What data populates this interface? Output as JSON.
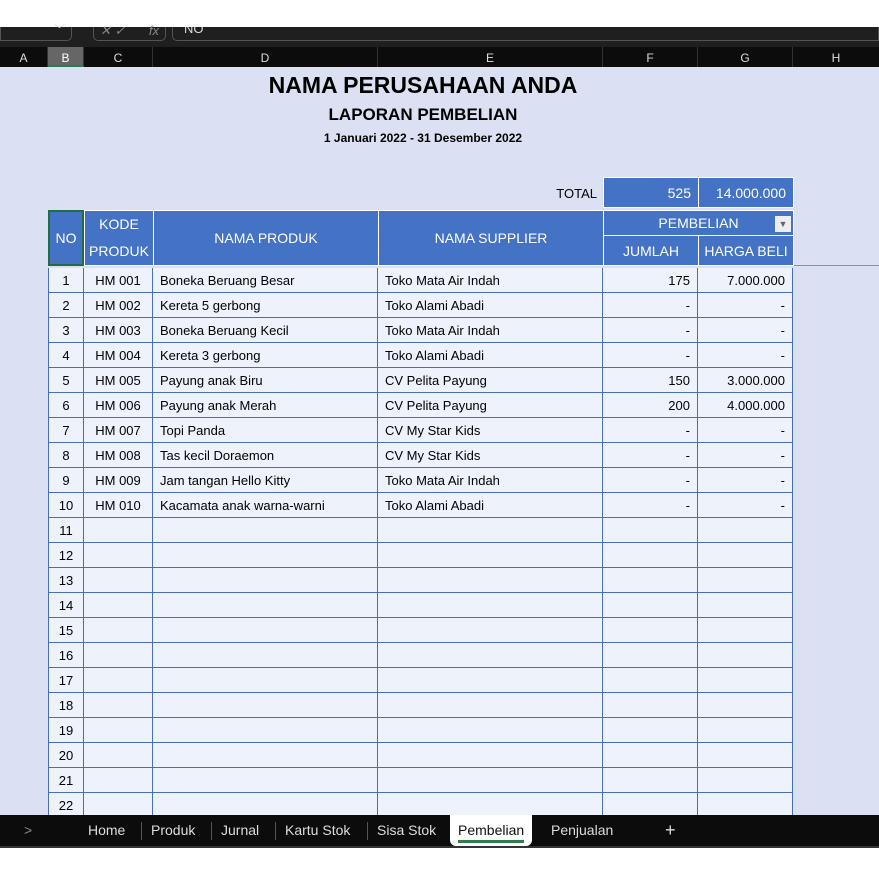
{
  "formula_bar": {
    "value": "NO",
    "fx": "fx"
  },
  "columns": [
    "A",
    "B",
    "C",
    "D",
    "E",
    "F",
    "G",
    "H"
  ],
  "selected_column": "B",
  "title": {
    "company": "NAMA PERUSAHAAN ANDA",
    "report": "LAPORAN PEMBELIAN",
    "period": "1 Januari 2022 - 31 Desember 2022"
  },
  "total": {
    "label": "TOTAL",
    "jumlah": "525",
    "harga": "14.000.000"
  },
  "headers": {
    "no": "NO",
    "kode": "KODE PRODUK",
    "nama": "NAMA PRODUK",
    "supplier": "NAMA SUPPLIER",
    "pembelian": "PEMBELIAN",
    "jumlah": "JUMLAH",
    "harga": "HARGA BELI"
  },
  "rows": [
    {
      "no": "1",
      "kode": "HM 001",
      "nama": "Boneka Beruang Besar",
      "supplier": "Toko Mata Air Indah",
      "jumlah": "175",
      "harga": "7.000.000"
    },
    {
      "no": "2",
      "kode": "HM 002",
      "nama": "Kereta 5 gerbong",
      "supplier": "Toko Alami Abadi",
      "jumlah": "-",
      "harga": "-"
    },
    {
      "no": "3",
      "kode": "HM 003",
      "nama": "Boneka Beruang Kecil",
      "supplier": "Toko Mata Air Indah",
      "jumlah": "-",
      "harga": "-"
    },
    {
      "no": "4",
      "kode": "HM 004",
      "nama": "Kereta 3 gerbong",
      "supplier": "Toko Alami Abadi",
      "jumlah": "-",
      "harga": "-"
    },
    {
      "no": "5",
      "kode": "HM 005",
      "nama": "Payung anak Biru",
      "supplier": "CV Pelita Payung",
      "jumlah": "150",
      "harga": "3.000.000"
    },
    {
      "no": "6",
      "kode": "HM 006",
      "nama": "Payung anak Merah",
      "supplier": "CV Pelita Payung",
      "jumlah": "200",
      "harga": "4.000.000"
    },
    {
      "no": "7",
      "kode": "HM 007",
      "nama": "Topi Panda",
      "supplier": "CV My Star Kids",
      "jumlah": "-",
      "harga": "-"
    },
    {
      "no": "8",
      "kode": "HM 008",
      "nama": "Tas kecil Doraemon",
      "supplier": "CV My Star Kids",
      "jumlah": "-",
      "harga": "-"
    },
    {
      "no": "9",
      "kode": "HM 009",
      "nama": "Jam tangan Hello Kitty",
      "supplier": "Toko Mata Air Indah",
      "jumlah": "-",
      "harga": "-"
    },
    {
      "no": "10",
      "kode": "HM 010",
      "nama": "Kacamata anak warna-warni",
      "supplier": "Toko Alami Abadi",
      "jumlah": "-",
      "harga": "-"
    },
    {
      "no": "11"
    },
    {
      "no": "12"
    },
    {
      "no": "13"
    },
    {
      "no": "14"
    },
    {
      "no": "15"
    },
    {
      "no": "16"
    },
    {
      "no": "17"
    },
    {
      "no": "18"
    },
    {
      "no": "19"
    },
    {
      "no": "20"
    },
    {
      "no": "21"
    },
    {
      "no": "22"
    }
  ],
  "sheet_tabs": [
    "Home",
    "Produk",
    "Jurnal",
    "Kartu Stok",
    "Sisa Stok",
    "Pembelian",
    "Penjualan"
  ],
  "active_tab": "Pembelian",
  "add_sheet": "+",
  "scroll_arrow": ">"
}
